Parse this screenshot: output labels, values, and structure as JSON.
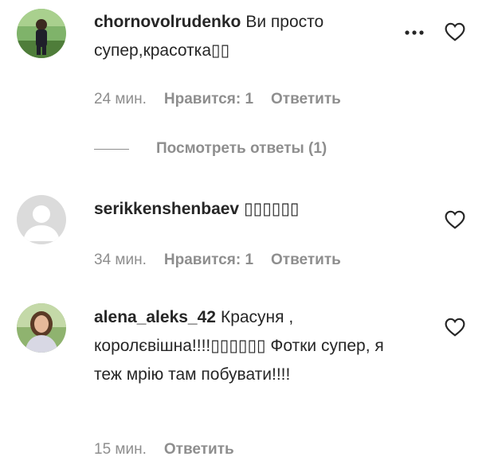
{
  "comments": [
    {
      "username": "chornovolrudenko",
      "text": "Ви просто супер,красотка▯▯",
      "time": "24 мин.",
      "likes_label": "Нравится: 1",
      "reply_label": "Ответить",
      "view_replies_label": "Посмотреть ответы (1)"
    },
    {
      "username": "serikkenshenbaev",
      "text": "▯▯▯▯▯▯",
      "time": "34 мин.",
      "likes_label": "Нравится: 1",
      "reply_label": "Ответить"
    },
    {
      "username": "alena_aleks_42",
      "text": "Красуня , королєвішна!!!!▯▯▯▯▯▯ Фотки супер, я теж мрію там побувати!!!!",
      "time": "15 мин.",
      "reply_label": "Ответить"
    }
  ],
  "icons": {
    "more": "more-horizontal-icon",
    "like": "heart-outline-icon"
  },
  "colors": {
    "text": "#262626",
    "secondary": "#8e8e8e",
    "default_avatar": "#dbdbdb"
  }
}
